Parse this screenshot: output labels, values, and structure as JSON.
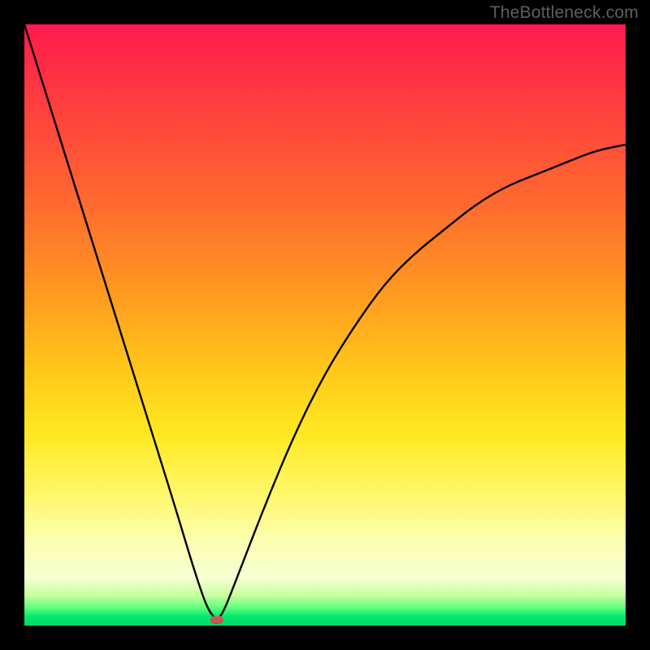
{
  "watermark": "TheBottleneck.com",
  "chart_data": {
    "type": "line",
    "title": "",
    "xlabel": "",
    "ylabel": "",
    "xlim": [
      0,
      100
    ],
    "ylim": [
      0,
      100
    ],
    "grid": false,
    "legend": false,
    "series": [
      {
        "name": "bottleneck-curve",
        "x": [
          0,
          5,
          10,
          15,
          20,
          25,
          28,
          30,
          31,
          32,
          33,
          35,
          40,
          45,
          50,
          55,
          60,
          65,
          70,
          75,
          80,
          85,
          90,
          95,
          100
        ],
        "y": [
          100,
          84,
          68,
          52,
          36,
          20,
          10,
          4,
          2,
          1,
          2,
          7,
          20,
          32,
          42,
          50,
          57,
          62,
          66,
          70,
          73,
          75,
          77,
          79,
          80
        ]
      }
    ],
    "marker": {
      "x": 32,
      "y": 1,
      "color": "#c45a4f"
    },
    "background_gradient": {
      "stops": [
        {
          "pos": 0,
          "color": "#ff1a4d"
        },
        {
          "pos": 0.45,
          "color": "#ff9b20"
        },
        {
          "pos": 0.68,
          "color": "#ffe820"
        },
        {
          "pos": 0.92,
          "color": "#f6ffd4"
        },
        {
          "pos": 0.97,
          "color": "#5eff7a"
        },
        {
          "pos": 1.0,
          "color": "#00d867"
        }
      ]
    },
    "frame_color": "#000000"
  }
}
